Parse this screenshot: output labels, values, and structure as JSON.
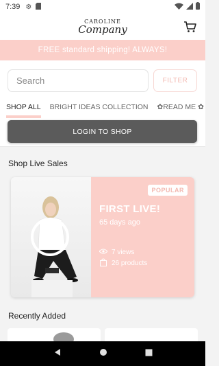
{
  "status_bar": {
    "time": "7:39"
  },
  "header": {
    "logo_line1": "CAROLINE",
    "logo_line2": "Company"
  },
  "banner": {
    "text": "FREE standard shipping! ALWAYS!"
  },
  "search": {
    "placeholder": "Search",
    "filter_label": "FILTER"
  },
  "tabs": [
    {
      "label": "SHOP ALL"
    },
    {
      "label": "BRIGHT IDEAS COLLECTION"
    },
    {
      "label": "✿READ ME ✿"
    }
  ],
  "login": {
    "label": "LOGIN TO SHOP"
  },
  "sections": {
    "live_sales_title": "Shop Live Sales",
    "recent_title": "Recently Added"
  },
  "live_card": {
    "badge": "POPULAR",
    "title": "FIRST LIVE!",
    "ago": "65 days ago",
    "views": "7 views",
    "products": "26 products"
  },
  "colors": {
    "brand_pink": "#fbcfc9",
    "login_button": "#5b5b5b"
  }
}
